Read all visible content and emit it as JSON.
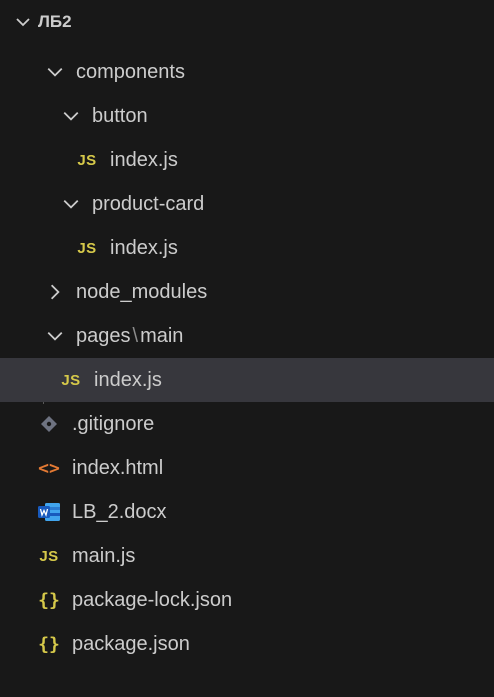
{
  "explorer": {
    "root": {
      "label": "ЛБ2",
      "expanded": true
    },
    "items": [
      {
        "kind": "folder",
        "label": "components",
        "expanded": true,
        "depth": 1
      },
      {
        "kind": "folder",
        "label": "button",
        "expanded": true,
        "depth": 2
      },
      {
        "kind": "file",
        "icon": "JS",
        "label": "index.js",
        "depth": 3
      },
      {
        "kind": "folder",
        "label": "product-card",
        "expanded": true,
        "depth": 2
      },
      {
        "kind": "file",
        "icon": "JS",
        "label": "index.js",
        "depth": 3
      },
      {
        "kind": "folder",
        "label": "node_modules",
        "expanded": false,
        "depth": 1
      },
      {
        "kind": "folder",
        "label_a": "pages",
        "label_sep": "\\",
        "label_b": "main",
        "expanded": true,
        "depth": 1
      },
      {
        "kind": "file",
        "icon": "JS",
        "label": "index.js",
        "depth": 2,
        "selected": true
      },
      {
        "kind": "file",
        "icon": "gitignore",
        "label": ".gitignore",
        "depth": 1
      },
      {
        "kind": "file",
        "icon": "<>",
        "label": "index.html",
        "depth": 1
      },
      {
        "kind": "file",
        "icon": "word",
        "label": "LB_2.docx",
        "depth": 1
      },
      {
        "kind": "file",
        "icon": "JS",
        "label": "main.js",
        "depth": 1
      },
      {
        "kind": "file",
        "icon": "{}",
        "label": "package-lock.json",
        "depth": 1
      },
      {
        "kind": "file",
        "icon": "{}",
        "label": "package.json",
        "depth": 1
      }
    ],
    "colors": {
      "background": "#181818",
      "selected": "#37373d",
      "text": "#cccccc",
      "js": "#d6c94a",
      "html": "#e37933",
      "word": "#2b7cd3",
      "git": "#8a8a9a"
    }
  }
}
